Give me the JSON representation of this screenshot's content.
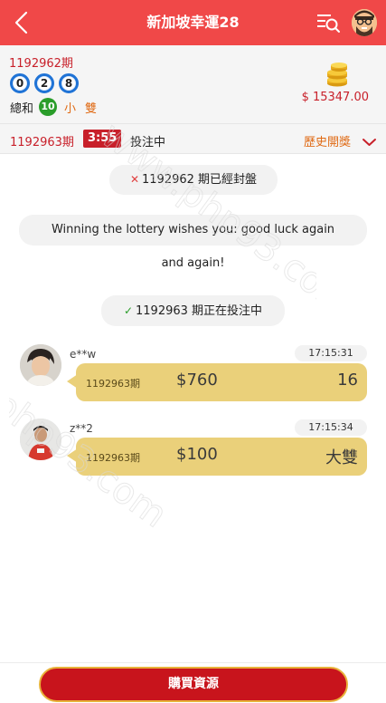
{
  "header": {
    "title": "新加坡幸運28",
    "colors": {
      "bar": "#f04848",
      "text": "#ffffff"
    }
  },
  "result": {
    "issue_label": "1192962期",
    "balls": [
      "0",
      "2",
      "8"
    ],
    "sum_label": "總和",
    "sum_value": "10",
    "size": "小",
    "parity": "雙",
    "balance": "$ 15347.00"
  },
  "status_bar": {
    "issue_label": "1192963期",
    "countdown": "3:55",
    "status": "投注中",
    "history_label": "歷史開獎"
  },
  "messages": {
    "closed_notice": "1192962 期已經封盤",
    "wish_line1": "Winning the lottery wishes you: good luck again",
    "wish_line2": "and again!",
    "open_notice": "1192963 期正在投注中"
  },
  "bets": [
    {
      "user": "e**w",
      "time": "17:15:31",
      "issue": "1192963期",
      "amount": "$760",
      "pick": "16"
    },
    {
      "user": "z**2",
      "time": "17:15:34",
      "issue": "1192963期",
      "amount": "$100",
      "pick": "大雙"
    }
  ],
  "footer": {
    "buy_label": "購買資源",
    "colors": {
      "button": "#c8141c",
      "border": "#e8b23a"
    }
  },
  "watermark_text": "www.php93.com",
  "icons": [
    "back-arrow-icon",
    "list-search-icon",
    "user-avatar-icon",
    "coins-icon",
    "chevron-down-icon",
    "cross-icon",
    "check-icon"
  ]
}
